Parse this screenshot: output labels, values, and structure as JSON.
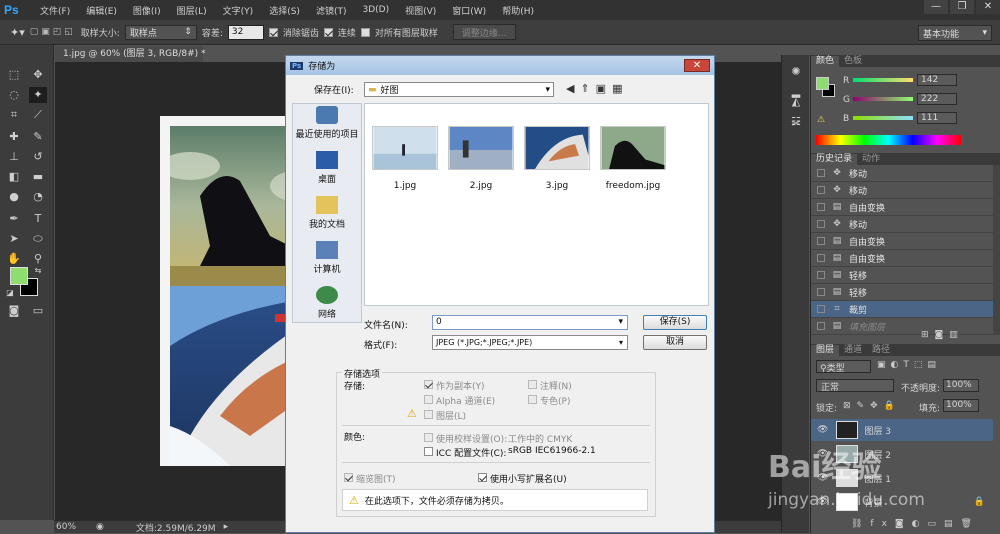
{
  "menubar": {
    "logo": "Ps",
    "items": [
      "文件(F)",
      "编辑(E)",
      "图像(I)",
      "图层(L)",
      "文字(Y)",
      "选择(S)",
      "滤镜(T)",
      "3D(D)",
      "视图(V)",
      "窗口(W)",
      "帮助(H)"
    ],
    "minimize": "—",
    "restore": "❐",
    "close": "✕"
  },
  "options": {
    "sample_size_label": "取样大小:",
    "sample_size_value": "取样点",
    "tolerance_label": "容差:",
    "tolerance_value": "32",
    "antialias_label": "消除锯齿",
    "contiguous_label": "连续",
    "sample_all_layers_label": "对所有图层取样",
    "refine_edge_label": "调整边缘...",
    "workspace": "基本功能"
  },
  "document": {
    "tab_title": "1.jpg @ 60% (图层 3, RGB/8#) *",
    "zoom": "60%",
    "doc_size": "文档:2.59M/6.29M"
  },
  "panels": {
    "color_tab": "颜色",
    "swatches_tab": "色板",
    "r_label": "R",
    "r_value": "142",
    "g_label": "G",
    "g_value": "222",
    "b_label": "B",
    "b_value": "111",
    "fg_color": "#8ede6f",
    "bg_color": "#000000",
    "history_tab": "历史记录",
    "actions_tab": "动作",
    "history_items": [
      "移动",
      "移动",
      "自由变换",
      "移动",
      "自由变换",
      "自由变换",
      "轻移",
      "轻移",
      "裁剪",
      "填充图层"
    ],
    "layers_tab": "图层",
    "channels_tab": "通道",
    "paths_tab": "路径",
    "kind_label": "类型",
    "blend_mode": "正常",
    "opacity_label": "不透明度:",
    "opacity_value": "100%",
    "lock_label": "锁定:",
    "fill_label": "填充:",
    "fill_value": "100%",
    "layers": [
      "图层 3",
      "图层 2",
      "图层 1",
      "背景"
    ]
  },
  "dialog": {
    "title": "存储为",
    "save_in_label": "保存在(I):",
    "save_in_value": "好图",
    "places": [
      "最近使用的项目",
      "桌面",
      "我的文档",
      "计算机",
      "网络"
    ],
    "files": [
      "1.jpg",
      "2.jpg",
      "3.jpg",
      "freedom.jpg"
    ],
    "filename_label": "文件名(N):",
    "filename_value": "0",
    "format_label": "格式(F):",
    "format_value": "JPEG (*.JPG;*.JPEG;*.JPE)",
    "save_button": "保存(S)",
    "cancel_button": "取消",
    "save_options_label": "存储选项",
    "save_label": "存储:",
    "as_copy": "作为副本(Y)",
    "notes": "注释(N)",
    "alpha": "Alpha 通道(E)",
    "spot": "专色(P)",
    "layers": "图层(L)",
    "color_label": "颜色:",
    "use_proof": "使用校样设置(O):",
    "proof_value": "工作中的 CMYK",
    "icc": "ICC 配置文件(C):",
    "icc_value": "sRGB IEC61966-2.1",
    "thumbnail": "缩览图(T)",
    "lowercase_ext": "使用小写扩展名(U)",
    "warning": "在此选项下，文件必须存储为拷贝。"
  },
  "watermark": {
    "brand": "Bai经验",
    "url": "jingyan.baidu.com"
  }
}
